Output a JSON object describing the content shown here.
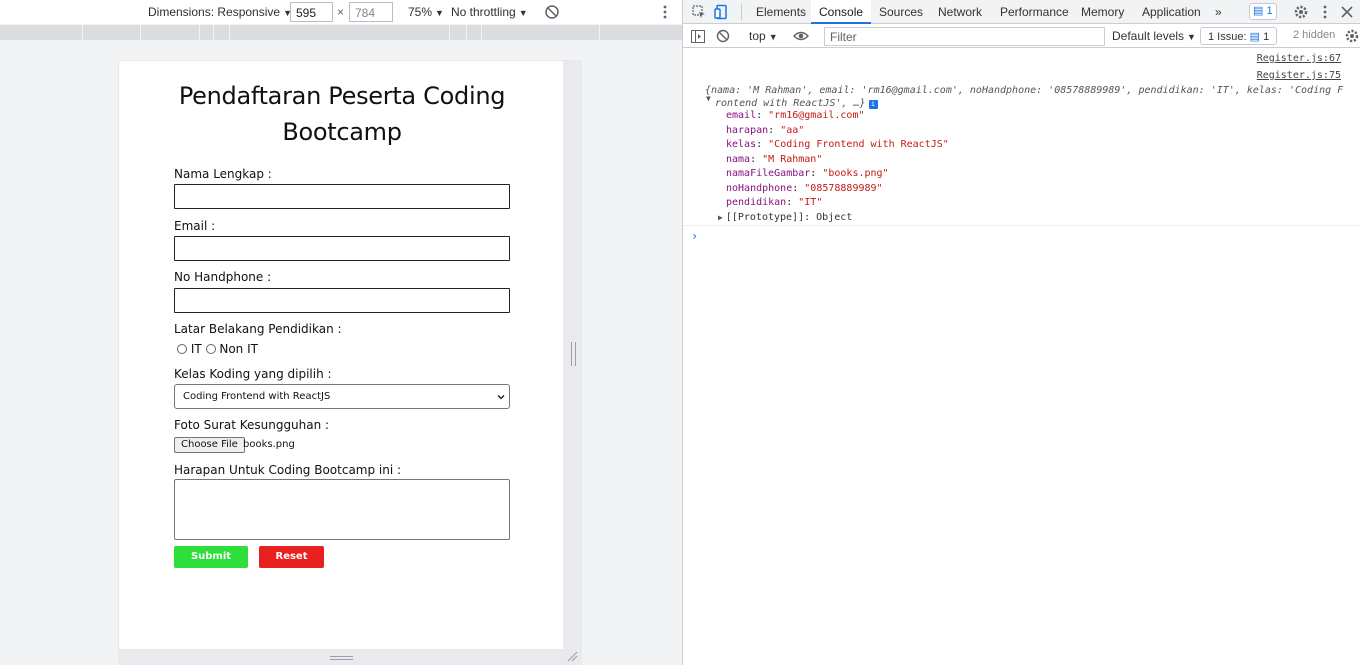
{
  "device_toolbar": {
    "dimensions": "Dimensions: Responsive",
    "width": "595",
    "times": "×",
    "height": "784",
    "zoom": "75%",
    "throttling": "No throttling"
  },
  "form": {
    "title": "Pendaftaran Peserta Coding Bootcamp",
    "name_label": "Nama Lengkap :",
    "email_label": "Email :",
    "phone_label": "No Handphone :",
    "education_label": "Latar Belakang Pendidikan :",
    "radio_it": "IT",
    "radio_non_it": "Non IT",
    "class_label": "Kelas Koding yang dipilih :",
    "class_value": "Coding Frontend with ReactJS",
    "photo_label": "Foto Surat Kesungguhan :",
    "choose_file": "Choose File",
    "file_name": "books.png",
    "hope_label": "Harapan Untuk Coding Bootcamp ini :",
    "submit": "Submit",
    "reset": "Reset"
  },
  "devtools": {
    "tabs": [
      "Elements",
      "Console",
      "Sources",
      "Network",
      "Performance",
      "Memory",
      "Application"
    ],
    "more": "»",
    "message_count": "1",
    "context": "top",
    "filter_placeholder": "Filter",
    "levels": "Default levels",
    "issues_label": "1 Issue:",
    "issues_count": "1",
    "hidden": "2 hidden"
  },
  "console": {
    "link1": "Register.js:67",
    "link2": "Register.js:75",
    "summary_line1": "{nama: 'M Rahman', email: 'rm16@gmail.com', noHandphone: '08578889989', pendidikan: 'IT', kelas: 'Coding F",
    "summary_line2": "rontend with ReactJS', …}",
    "info": "i",
    "props": [
      {
        "key": "email",
        "value": "\"rm16@gmail.com\""
      },
      {
        "key": "harapan",
        "value": "\"aa\""
      },
      {
        "key": "kelas",
        "value": "\"Coding Frontend with ReactJS\""
      },
      {
        "key": "nama",
        "value": "\"M Rahman\""
      },
      {
        "key": "namaFileGambar",
        "value": "\"books.png\""
      },
      {
        "key": "noHandphone",
        "value": "\"08578889989\""
      },
      {
        "key": "pendidikan",
        "value": "\"IT\""
      }
    ],
    "prototype": "[[Prototype]]: Object",
    "prompt": "›"
  }
}
